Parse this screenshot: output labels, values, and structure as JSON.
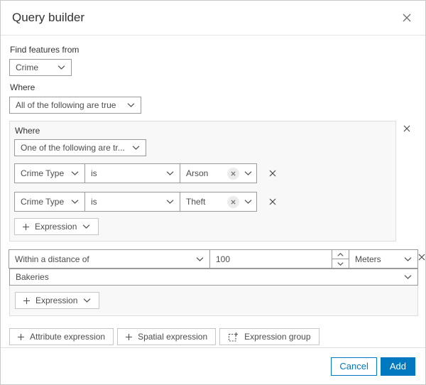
{
  "header": {
    "title": "Query builder"
  },
  "colors": {
    "accent_blue": "#0079c1",
    "group_bg": "#f8f8f8",
    "input_border": "#9a9a9a"
  },
  "find": {
    "label": "Find features from",
    "layer_value": "Crime"
  },
  "where": {
    "label": "Where",
    "operator_value": "All of the following are true"
  },
  "attribute_group": {
    "label": "Where",
    "operator_value": "One of the following are tr...",
    "rows": [
      {
        "field": "Crime Type",
        "operator": "is",
        "value": "Arson"
      },
      {
        "field": "Crime Type",
        "operator": "is",
        "value": "Theft"
      }
    ],
    "add_expression_label": "Expression"
  },
  "spatial_group": {
    "relation_value": "Within a distance of",
    "distance_value": "100",
    "unit_value": "Meters",
    "layer_value": "Bakeries",
    "add_expression_label": "Expression"
  },
  "toolbar": {
    "attribute_expression_label": "Attribute expression",
    "spatial_expression_label": "Spatial expression",
    "expression_group_label": "Expression group"
  },
  "footer": {
    "cancel_label": "Cancel",
    "add_label": "Add"
  }
}
